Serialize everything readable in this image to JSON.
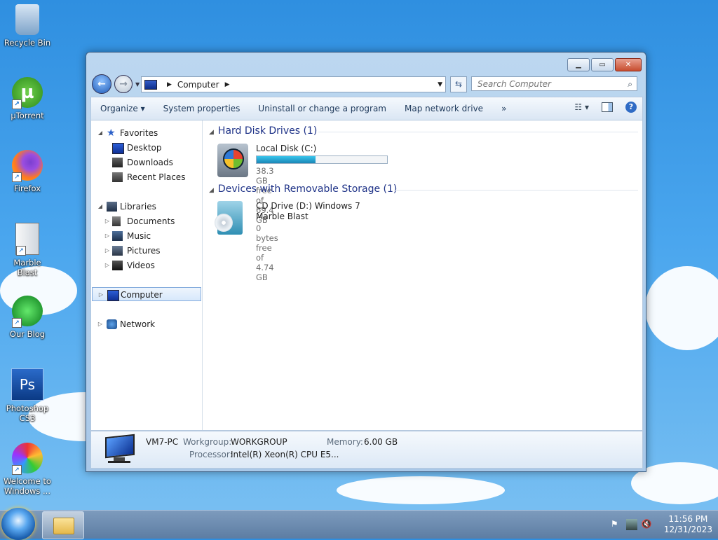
{
  "desktop": {
    "icons": [
      {
        "label": "Recycle Bin"
      },
      {
        "label": "µTorrent"
      },
      {
        "label": "Firefox"
      },
      {
        "label": "Marble Blast"
      },
      {
        "label": "Our Blog"
      },
      {
        "label": "Photoshop CS3"
      },
      {
        "label": "Welcome to Windows ..."
      }
    ]
  },
  "window": {
    "address": {
      "crumb": "Computer"
    },
    "search_placeholder": "Search Computer",
    "toolbar": {
      "organize": "Organize",
      "system_properties": "System properties",
      "uninstall": "Uninstall or change a program",
      "map_drive": "Map network drive",
      "more": "»"
    },
    "nav": {
      "favorites": "Favorites",
      "desktop": "Desktop",
      "downloads": "Downloads",
      "recent": "Recent Places",
      "libraries": "Libraries",
      "documents": "Documents",
      "music": "Music",
      "pictures": "Pictures",
      "videos": "Videos",
      "computer": "Computer",
      "network": "Network"
    },
    "groups": {
      "hdd_title": "Hard Disk Drives (1)",
      "removable_title": "Devices with Removable Storage (1)"
    },
    "drives": {
      "c_name": "Local Disk (C:)",
      "c_free": "38.3 GB free of 69.4 GB",
      "c_used_fraction": 0.45,
      "d_name": "CD Drive (D:) Windows 7 Marble Blast",
      "d_free": "0 bytes free of 4.74 GB"
    },
    "details": {
      "pc_name": "VM7-PC",
      "workgroup_label": "Workgroup:",
      "workgroup": "WORKGROUP",
      "memory_label": "Memory:",
      "memory": "6.00 GB",
      "processor_label": "Processor:",
      "processor": "Intel(R) Xeon(R) CPU E5..."
    }
  },
  "taskbar": {
    "time": "11:56 PM",
    "date": "12/31/2023"
  }
}
